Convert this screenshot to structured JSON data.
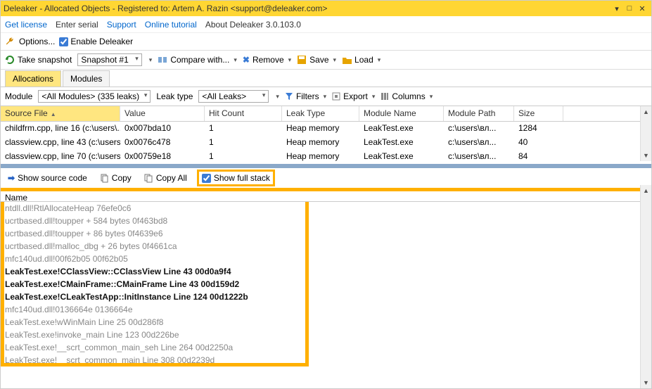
{
  "titlebar": {
    "text": "Deleaker - Allocated Objects - Registered to: Artem A. Razin <support@deleaker.com>"
  },
  "menubar": {
    "get_license": "Get license",
    "enter_serial": "Enter serial",
    "support": "Support",
    "online_tutorial": "Online tutorial",
    "about": "About Deleaker 3.0.103.0"
  },
  "optbar": {
    "options": "Options...",
    "enable": "Enable Deleaker"
  },
  "toolbar": {
    "take_snapshot": "Take snapshot",
    "snapshot_sel": "Snapshot #1",
    "compare": "Compare with...",
    "remove": "Remove",
    "save": "Save",
    "load": "Load"
  },
  "tabs": {
    "allocations": "Allocations",
    "modules": "Modules"
  },
  "filterbar": {
    "module_label": "Module",
    "module_value": "<All Modules> (335 leaks)",
    "leaktype_label": "Leak type",
    "leaktype_value": "<All Leaks>",
    "filters": "Filters",
    "export": "Export",
    "columns": "Columns"
  },
  "columns": {
    "c0": "Source File",
    "c1": "Value",
    "c2": "Hit Count",
    "c3": "Leak Type",
    "c4": "Module Name",
    "c5": "Module Path",
    "c6": "Size"
  },
  "rows": [
    {
      "src": "childfrm.cpp, line 16 (c:\\users\\...",
      "val": "0x007bda10",
      "hit": "1",
      "lt": "Heap memory",
      "mn": "LeakTest.exe",
      "mp": "c:\\users\\вл...",
      "sz": "1284"
    },
    {
      "src": "classview.cpp, line 43 (c:\\users...",
      "val": "0x0076c478",
      "hit": "1",
      "lt": "Heap memory",
      "mn": "LeakTest.exe",
      "mp": "c:\\users\\вл...",
      "sz": "40"
    },
    {
      "src": "classview.cpp, line 70 (c:\\users...",
      "val": "0x00759e18",
      "hit": "1",
      "lt": "Heap memory",
      "mn": "LeakTest.exe",
      "mp": "c:\\users\\вл...",
      "sz": "84"
    }
  ],
  "panelbar": {
    "show_source": "Show source code",
    "copy": "Copy",
    "copy_all": "Copy All",
    "show_full_stack": "Show full stack"
  },
  "stack_header": "Name",
  "stack": [
    {
      "t": "ntdll.dll!RtlAllocateHeap 76efe0c6",
      "b": false
    },
    {
      "t": "ucrtbased.dll!toupper + 584 bytes 0f463bd8",
      "b": false
    },
    {
      "t": "ucrtbased.dll!toupper + 86 bytes 0f4639e6",
      "b": false
    },
    {
      "t": "ucrtbased.dll!malloc_dbg + 26 bytes 0f4661ca",
      "b": false
    },
    {
      "t": "mfc140ud.dll!00f62b05 00f62b05",
      "b": false
    },
    {
      "t": "LeakTest.exe!CClassView::CClassView Line 43 00d0a9f4",
      "b": true
    },
    {
      "t": "LeakTest.exe!CMainFrame::CMainFrame Line 43 00d159d2",
      "b": true
    },
    {
      "t": "LeakTest.exe!CLeakTestApp::InitInstance Line 124 00d1222b",
      "b": true
    },
    {
      "t": "mfc140ud.dll!0136664e 0136664e",
      "b": false
    },
    {
      "t": "LeakTest.exe!wWinMain Line 25 00d286f8",
      "b": false
    },
    {
      "t": "LeakTest.exe!invoke_main Line 123 00d226be",
      "b": false
    },
    {
      "t": "LeakTest.exe!__scrt_common_main_seh Line 264 00d2250a",
      "b": false
    },
    {
      "t": "LeakTest.exe!__scrt_common_main Line 308 00d2239d",
      "b": false
    }
  ]
}
